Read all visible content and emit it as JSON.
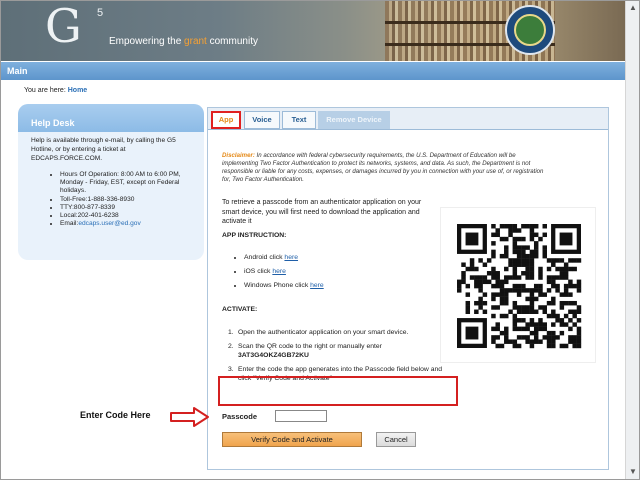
{
  "banner": {
    "logo_letter": "G",
    "logo_number": "5",
    "tagline_prefix": "Empowering the ",
    "tagline_highlight": "grant",
    "tagline_suffix": " community",
    "accent_color": "#f6a133"
  },
  "mainbar": {
    "title": "Main"
  },
  "breadcrumb": {
    "prefix": "You are here: ",
    "home": "Home"
  },
  "helpdesk": {
    "title": "Help Desk",
    "intro": "Help is available through e-mail, by calling the G5 Hotline, or by entering a ticket at EDCAPS.FORCE.COM.",
    "items": [
      "Hours Of Operation: 8:00 AM to 6:00 PM, Monday - Friday, EST, except on Federal holidays.",
      "Toll-Free:1-888-336-8930",
      "TTY:800-877-8339",
      "Local:202-401-6238"
    ],
    "email_label": "Email:",
    "email": "edcaps.user@ed.gov"
  },
  "tabs": [
    {
      "label": "App",
      "active": true
    },
    {
      "label": "Voice",
      "active": false
    },
    {
      "label": "Text",
      "active": false
    },
    {
      "label": "Remove Device",
      "disabled": true
    }
  ],
  "disclaimer": {
    "label": "Disclaimer:",
    "text": " In accordance with federal cybersecurity requirements, the U.S. Department of Education will be implementing Two Factor Authentication to protect its networks, systems, and data. As such, the Department is not responsible or liable for any costs, expenses, or damages incurred by you in connection with your use of, or registration for, Two Factor Authentication."
  },
  "retrieve_text": "To retrieve a passcode from an authenticator application on your smart device, you will first need to download the application and activate it",
  "app_instruction": {
    "title": "APP INSTRUCTION:",
    "items": [
      {
        "prefix": "Android click ",
        "link": "here"
      },
      {
        "prefix": "iOS click ",
        "link": "here"
      },
      {
        "prefix": "Windows Phone click ",
        "link": "here"
      }
    ]
  },
  "activate": {
    "title": "ACTIVATE:",
    "steps": [
      {
        "num": "1.",
        "text": "Open the authenticator application on your smart device."
      },
      {
        "num": "2.",
        "text": "Scan the QR code to the right or manually enter ",
        "code": "3AT3G4OKZ4GB72KU"
      },
      {
        "num": "3.",
        "text": "Enter the code the app generates into the Passcode field below and click \"Verify Code and Activate\""
      }
    ]
  },
  "form": {
    "passcode_label": "Passcode",
    "passcode_value": "",
    "verify_label": "Verify Code and Activate",
    "cancel_label": "Cancel"
  },
  "annotation": {
    "enter_code_label": "Enter Code Here",
    "highlight_color": "#d42020"
  }
}
